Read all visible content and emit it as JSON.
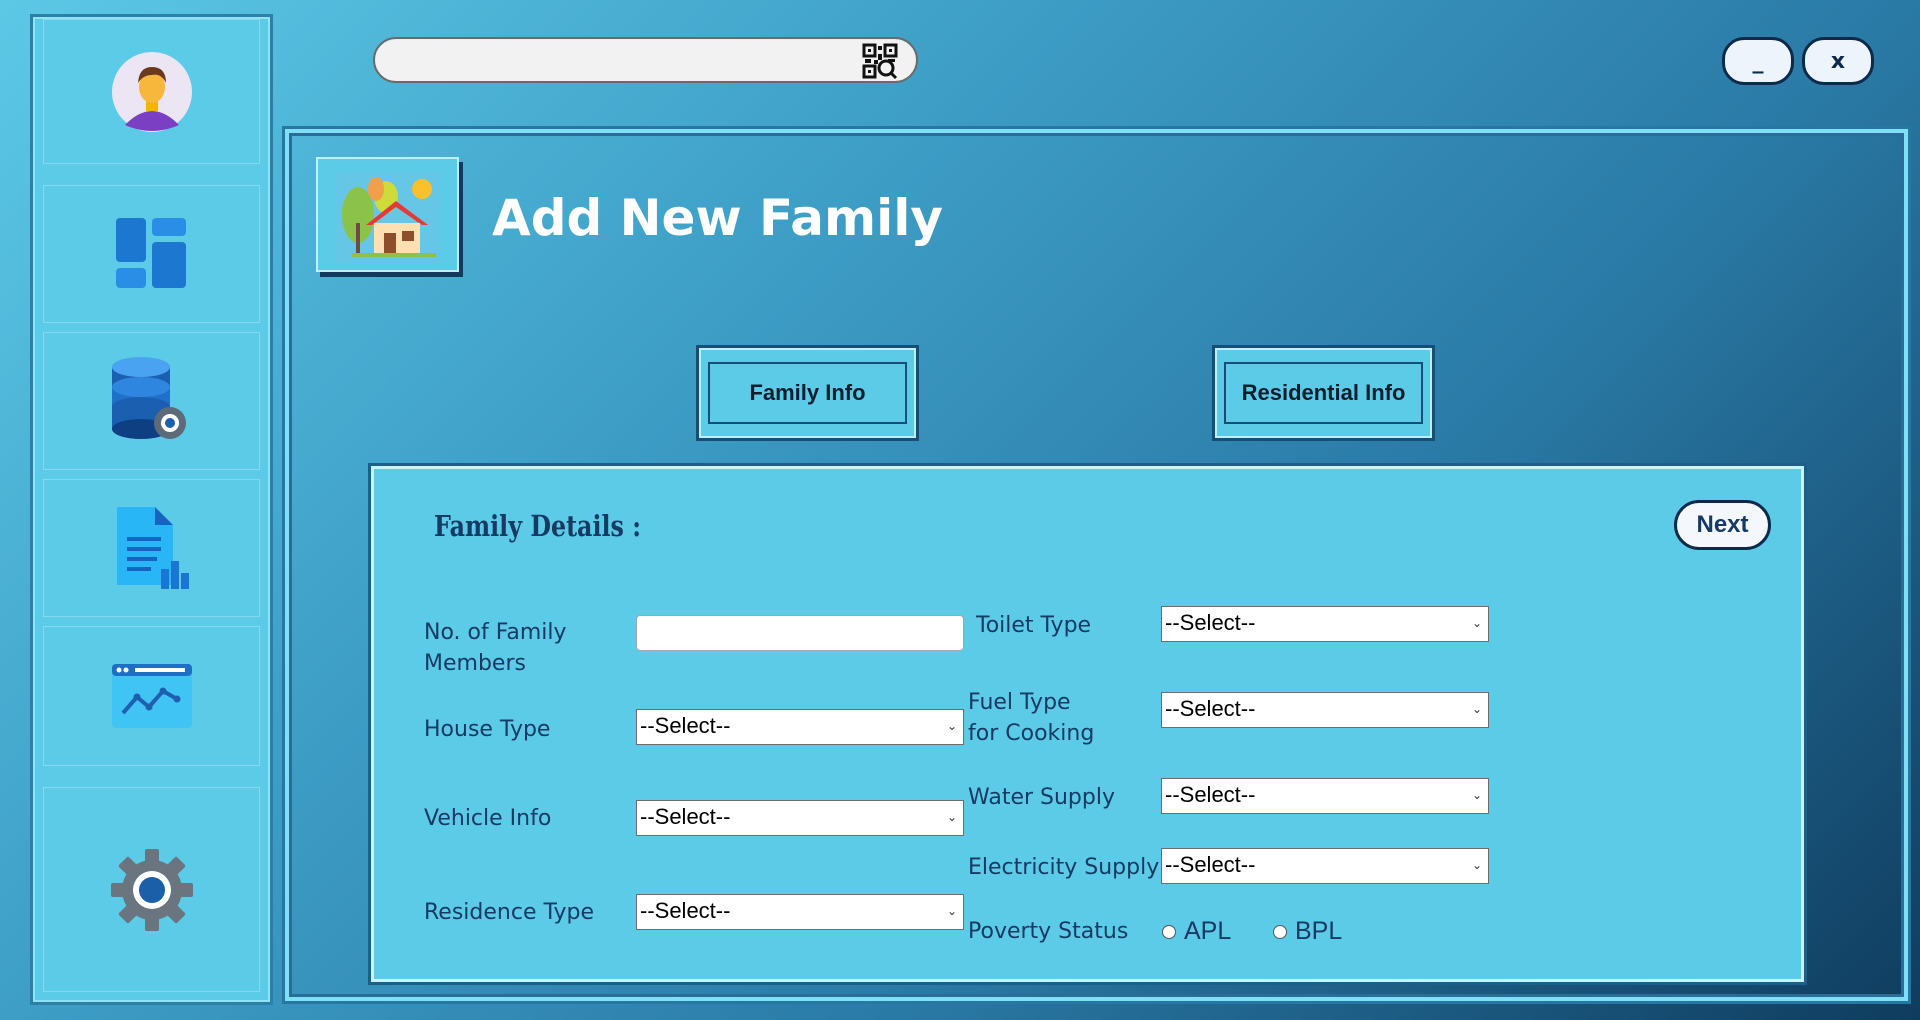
{
  "search": {
    "placeholder": "",
    "icon": "qr-scan-icon"
  },
  "window": {
    "minimize_label": "_",
    "close_label": "x"
  },
  "sidebar": {
    "items": [
      {
        "icon": "user-avatar-icon"
      },
      {
        "icon": "dashboard-icon"
      },
      {
        "icon": "database-settings-icon"
      },
      {
        "icon": "report-document-icon"
      },
      {
        "icon": "analytics-chart-icon"
      },
      {
        "icon": "gear-icon"
      }
    ]
  },
  "header": {
    "title": "Add New Family",
    "logo_icon": "house-icon"
  },
  "tabs": [
    {
      "label": "Family Info"
    },
    {
      "label": "Residential Info"
    }
  ],
  "form": {
    "section_title": "Family Details :",
    "next_label": "Next",
    "left": {
      "members_label": "No. of Family\nMembers",
      "members_value": "",
      "house_type_label": "House Type",
      "house_type_value": "--Select--",
      "vehicle_label": "Vehicle Info",
      "vehicle_value": "--Select--",
      "residence_label": "Residence Type",
      "residence_value": "--Select--"
    },
    "right": {
      "toilet_label": "Toilet Type",
      "toilet_value": "--Select--",
      "fuel_label_1": "Fuel Type",
      "fuel_label_2": "for Cooking",
      "fuel_value": "--Select--",
      "water_label": "Water Supply",
      "water_value": "--Select--",
      "electricity_label": "Electricity Supply",
      "electricity_value": "--Select--",
      "poverty_label": "Poverty Status",
      "poverty_options": [
        "APL",
        "BPL"
      ]
    }
  },
  "colors": {
    "accent": "#5ccbe8",
    "text_dark": "#163a63",
    "border_dark": "#0c2a4a"
  }
}
